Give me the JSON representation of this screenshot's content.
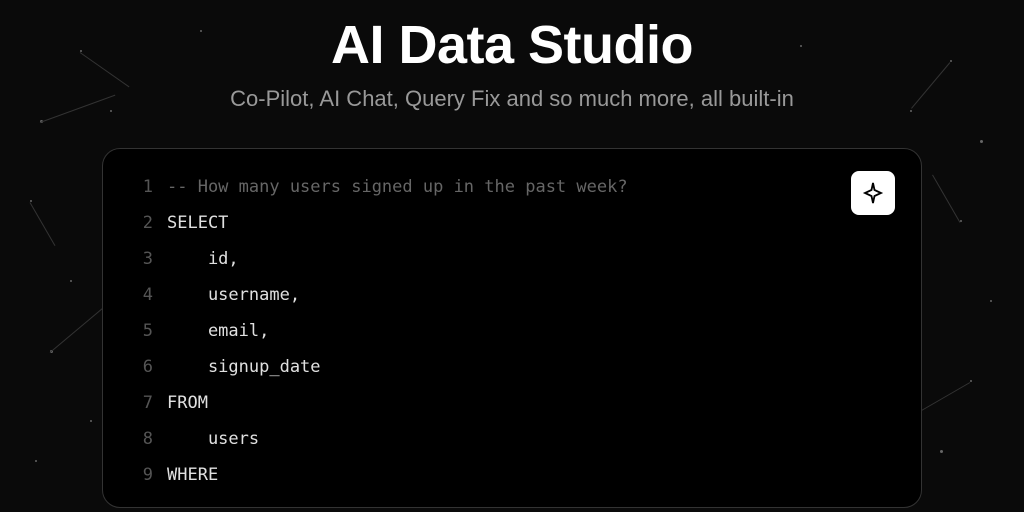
{
  "hero": {
    "title": "AI Data Studio",
    "subtitle": "Co-Pilot, AI Chat, Query Fix and so much more, all built-in"
  },
  "editor": {
    "lines": [
      {
        "num": "1",
        "text": "-- How many users signed up in the past week?",
        "type": "comment",
        "indent": 0
      },
      {
        "num": "2",
        "text": "SELECT",
        "type": "keyword",
        "indent": 0
      },
      {
        "num": "3",
        "text": "id,",
        "type": "identifier",
        "indent": 1
      },
      {
        "num": "4",
        "text": "username,",
        "type": "identifier",
        "indent": 1
      },
      {
        "num": "5",
        "text": "email,",
        "type": "identifier",
        "indent": 1
      },
      {
        "num": "6",
        "text": "signup_date",
        "type": "identifier",
        "indent": 1
      },
      {
        "num": "7",
        "text": "FROM",
        "type": "keyword",
        "indent": 0
      },
      {
        "num": "8",
        "text": "users",
        "type": "identifier",
        "indent": 1
      },
      {
        "num": "9",
        "text": "WHERE",
        "type": "keyword",
        "indent": 0
      }
    ],
    "ai_button_label": "AI Assist"
  }
}
